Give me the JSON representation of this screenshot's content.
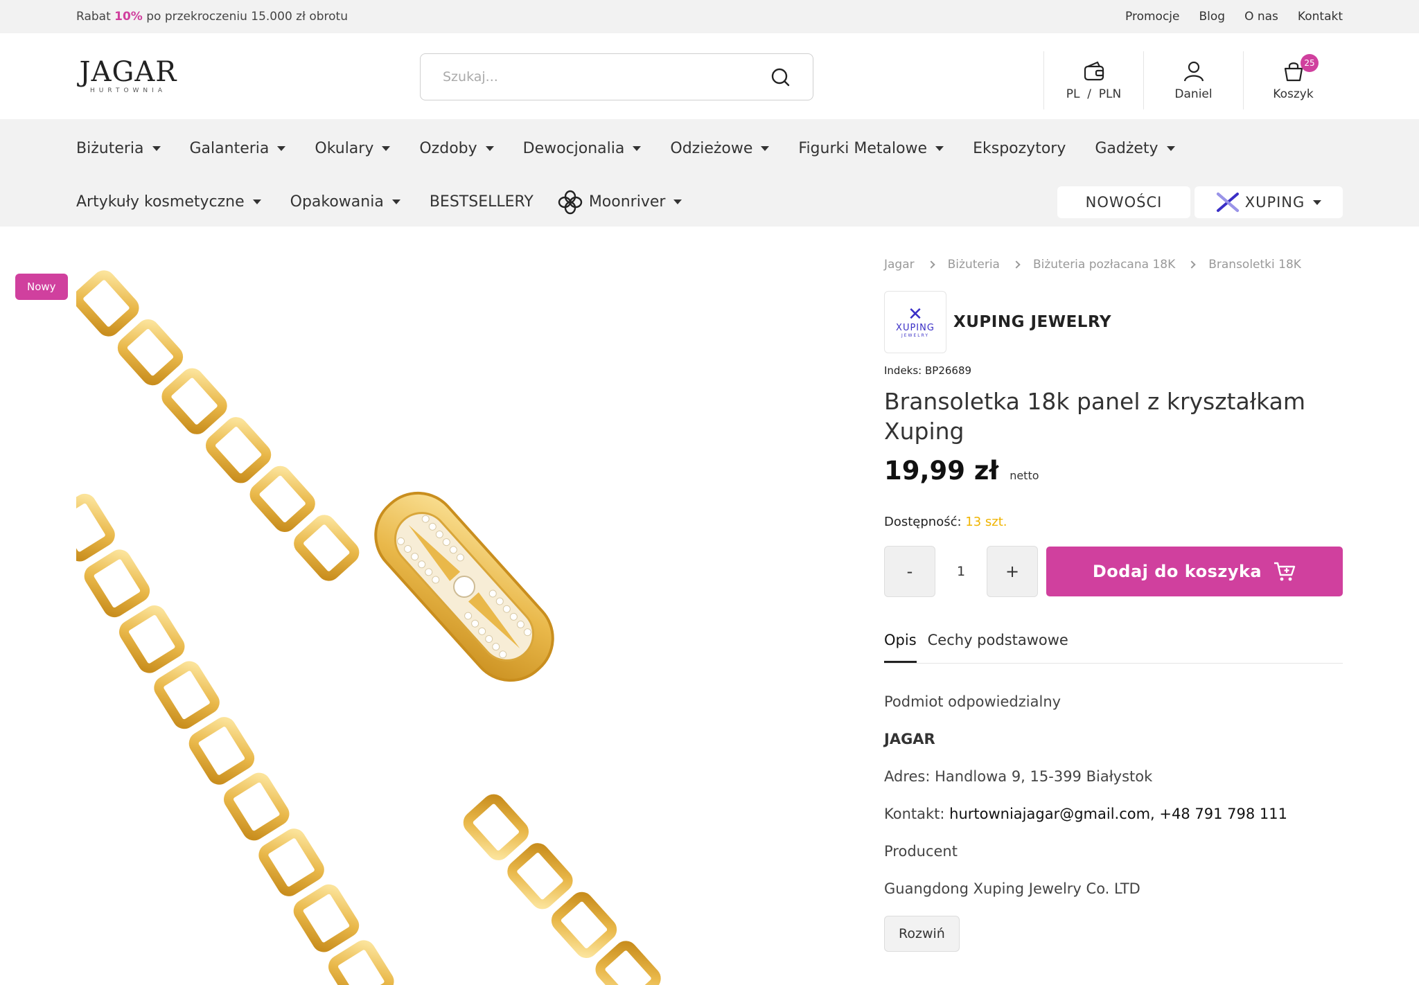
{
  "topbar": {
    "promo_prefix": "Rabat ",
    "promo_highlight": "10%",
    "promo_suffix": " po przekroczeniu 15.000 zł obrotu",
    "links": [
      "Promocje",
      "Blog",
      "O nas",
      "Kontakt"
    ]
  },
  "header": {
    "logo_main": "JAGAR",
    "logo_sub": "HURTOWNIA",
    "search_placeholder": "Szukaj...",
    "currency": "PL  /  PLN",
    "account": "Daniel",
    "cart": "Koszyk",
    "cart_count": "25"
  },
  "nav": {
    "row1": [
      "Biżuteria",
      "Galanteria",
      "Okulary",
      "Ozdoby",
      "Dewocjonalia",
      "Odzieżowe",
      "Figurki Metalowe",
      "Ekspozytory",
      "Gadżety"
    ],
    "row1_caret": [
      true,
      true,
      true,
      true,
      true,
      true,
      true,
      false,
      true
    ],
    "row2": [
      "Artykuły kosmetyczne",
      "Opakowania",
      "BESTSELLERY",
      "Moonriver"
    ],
    "row2_caret": [
      true,
      true,
      false,
      true
    ],
    "nowosci": "NOWOŚCI",
    "xuping": "XUPING"
  },
  "product": {
    "badge": "Nowy",
    "breadcrumb": [
      "Jagar",
      "Biżuteria",
      "Biżuteria pozłacana 18K",
      "Bransoletki 18K"
    ],
    "brand_logo_text": "XUPING",
    "brand_logo_sub": "JEWELRY",
    "brand_name": "XUPING JEWELRY",
    "sku": "Indeks: BP26689",
    "title": "Bransoletka 18k panel z kryształkam Xuping",
    "price": "19,99 zł",
    "price_note": "netto",
    "availability_label": "Dostępność: ",
    "availability_value": "13 szt.",
    "qty_minus": "-",
    "qty": "1",
    "qty_plus": "+",
    "add_to_cart": "Dodaj do koszyka"
  },
  "tabs": [
    "Opis",
    "Cechy podstawowe"
  ],
  "description": {
    "line1": "Podmiot odpowiedzialny",
    "line2": "JAGAR",
    "line3_label": "Adres: ",
    "line3_value": "Handlowa 9, 15-399 Białystok",
    "line4_label": "Kontakt: ",
    "line4_value": "hurtowniajagar@gmail.com, +48 791 798 111",
    "line5": "Producent",
    "line6": "Guangdong Xuping Jewelry Co. LTD",
    "expand": "Rozwiń"
  },
  "colors": {
    "accent": "#d0409e",
    "availability": "#f0b400",
    "brand_blue": "#3a2fc6",
    "gold": "#e9b84a"
  },
  "icons": [
    "search-icon",
    "wallet-icon",
    "user-icon",
    "cart-icon",
    "moonriver-icon",
    "xuping-icon",
    "add-cart-icon"
  ]
}
